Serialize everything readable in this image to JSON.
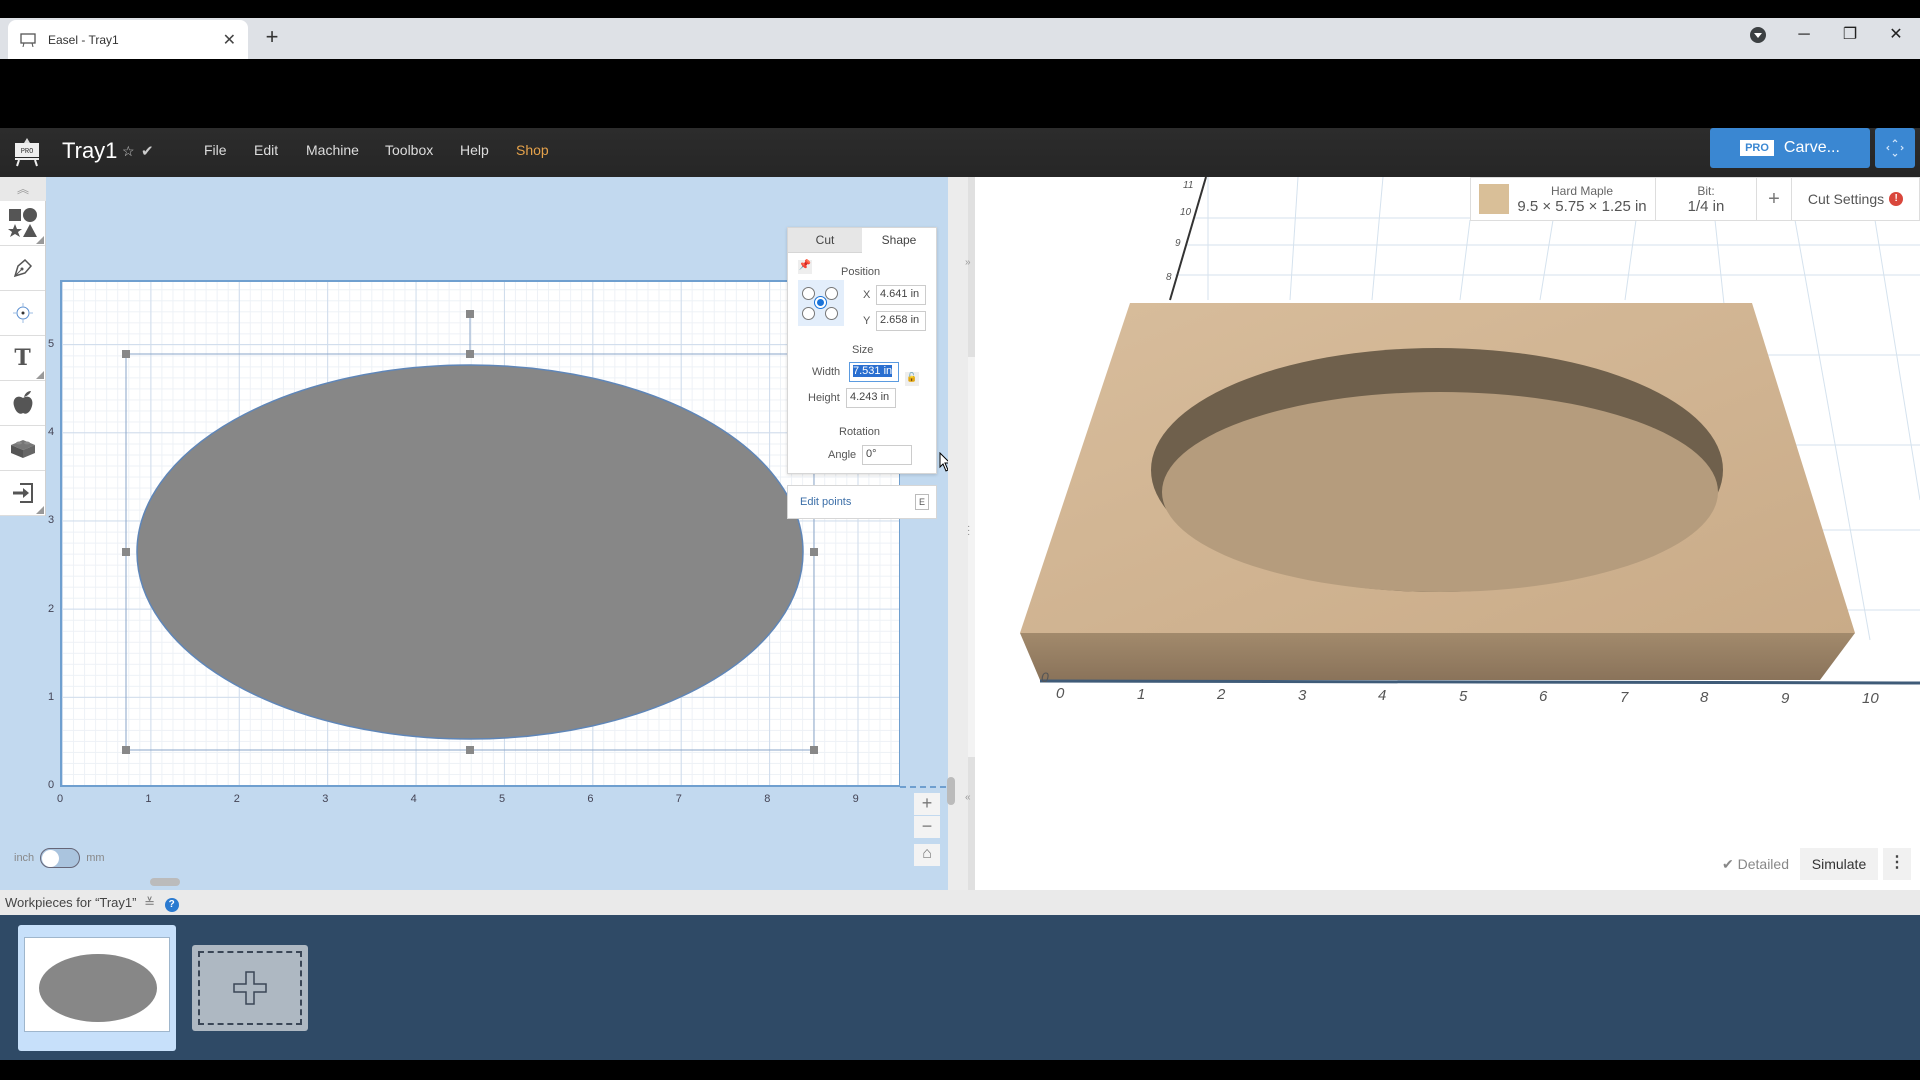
{
  "browser": {
    "tab_title": "Easel - Tray1",
    "new_tab_label": "+",
    "controls": {
      "minimize": "─",
      "restore": "❐",
      "close": "✕"
    }
  },
  "app": {
    "logo_label": "PRO",
    "doc_title": "Tray1",
    "star_icon": "☆",
    "saved_icon": "✔",
    "menu": [
      "File",
      "Edit",
      "Machine",
      "Toolbox",
      "Help",
      "Shop"
    ],
    "shop_color": "#e5a24b",
    "carve": {
      "badge": "PRO",
      "label": "Carve..."
    },
    "expand_icon": "‹ ›",
    "accent": "#3a87d2"
  },
  "toolbar": {
    "collapse_icon": "︽",
    "tools": [
      {
        "name": "shapes",
        "icon": "shapes-icon"
      },
      {
        "name": "pen",
        "icon": "pen-icon"
      },
      {
        "name": "point",
        "icon": "target-icon"
      },
      {
        "name": "text",
        "icon": "text-icon",
        "glyph": "T"
      },
      {
        "name": "icons",
        "icon": "apple-icon"
      },
      {
        "name": "apps",
        "icon": "lego-brick-icon"
      },
      {
        "name": "import",
        "icon": "import-icon"
      }
    ]
  },
  "canvas": {
    "x_ticks": [
      "0",
      "1",
      "2",
      "3",
      "4",
      "5",
      "6",
      "7",
      "8",
      "9"
    ],
    "y_ticks": [
      "0",
      "1",
      "2",
      "3",
      "4",
      "5"
    ],
    "unit_toggle": {
      "left": "inch",
      "right": "mm",
      "selected": "inch"
    },
    "zoom_in": "+",
    "zoom_out": "−",
    "home_icon": "⌂"
  },
  "shape_panel": {
    "tabs": [
      "Cut",
      "Shape"
    ],
    "active_tab": "Shape",
    "position_heading": "Position",
    "x_label": "X",
    "x_value": "4.641 in",
    "y_label": "Y",
    "y_value": "2.658 in",
    "size_heading": "Size",
    "width_label": "Width",
    "width_value": "7.531 in",
    "height_label": "Height",
    "height_value": "4.243 in",
    "rotation_heading": "Rotation",
    "angle_label": "Angle",
    "angle_value": "0°",
    "edit_points_label": "Edit points",
    "edit_points_shortcut": "E"
  },
  "preview": {
    "material_name": "Hard Maple",
    "material_dims": "9.5 × 5.75 × 1.25 in",
    "bit_label": "Bit:",
    "bit_value": "1/4 in",
    "add_label": "+",
    "cut_settings_label": "Cut Settings",
    "cut_settings_alert": "!",
    "x_ticks": [
      "0",
      "1",
      "2",
      "3",
      "4",
      "5",
      "6",
      "7",
      "8",
      "9",
      "10"
    ],
    "y_ticks": [
      "8",
      "9",
      "10",
      "11"
    ],
    "z_zero": "0",
    "detailed_label": "Detailed",
    "simulate_label": "Simulate",
    "more_icon": "⋮"
  },
  "workpieces": {
    "label": "Workpieces for “Tray1”",
    "expand_icon": "≚",
    "help_icon": "?"
  }
}
